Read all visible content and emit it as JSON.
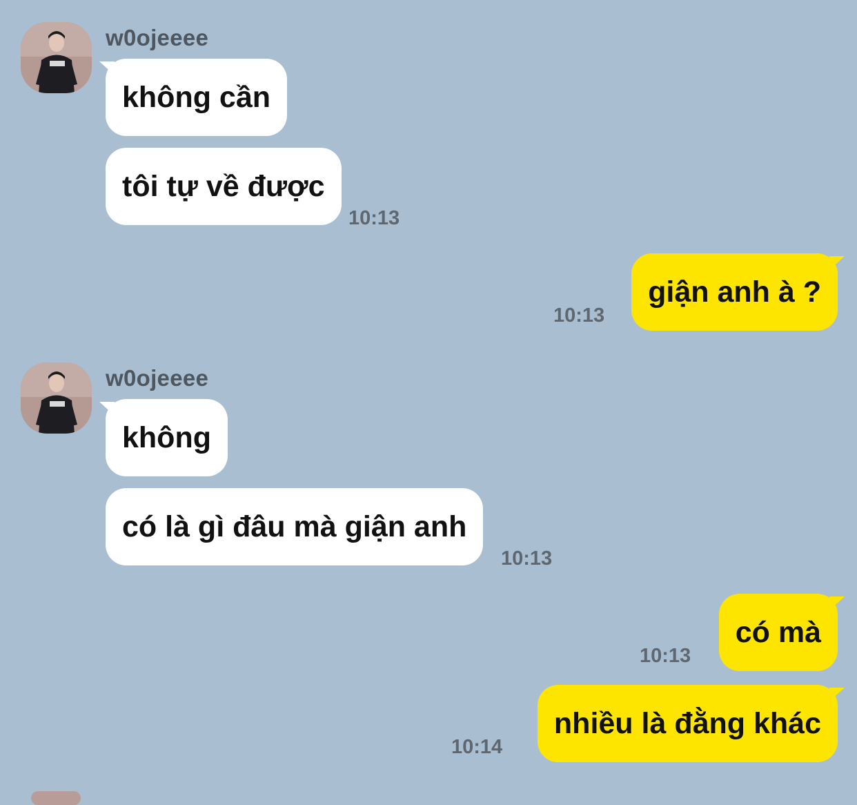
{
  "contact": {
    "name": "w0ojeeee"
  },
  "messages": [
    {
      "from": "them",
      "text": "không cần"
    },
    {
      "from": "them",
      "text": "tôi tự về được",
      "time": "10:13"
    },
    {
      "from": "me",
      "text": "giận anh à ?",
      "time": "10:13"
    },
    {
      "from": "them",
      "text": "không"
    },
    {
      "from": "them",
      "text": "có là gì đâu mà giận anh",
      "time": "10:13"
    },
    {
      "from": "me",
      "text": "có mà",
      "time": "10:13"
    },
    {
      "from": "me",
      "text": "nhiều là đằng khác",
      "time": "10:14"
    }
  ],
  "colors": {
    "background": "#a9bfd1",
    "incoming_bubble": "#ffffff",
    "outgoing_bubble": "#fee500",
    "timestamp": "#5e6670"
  },
  "icons": {
    "avatar": "profile-photo"
  }
}
